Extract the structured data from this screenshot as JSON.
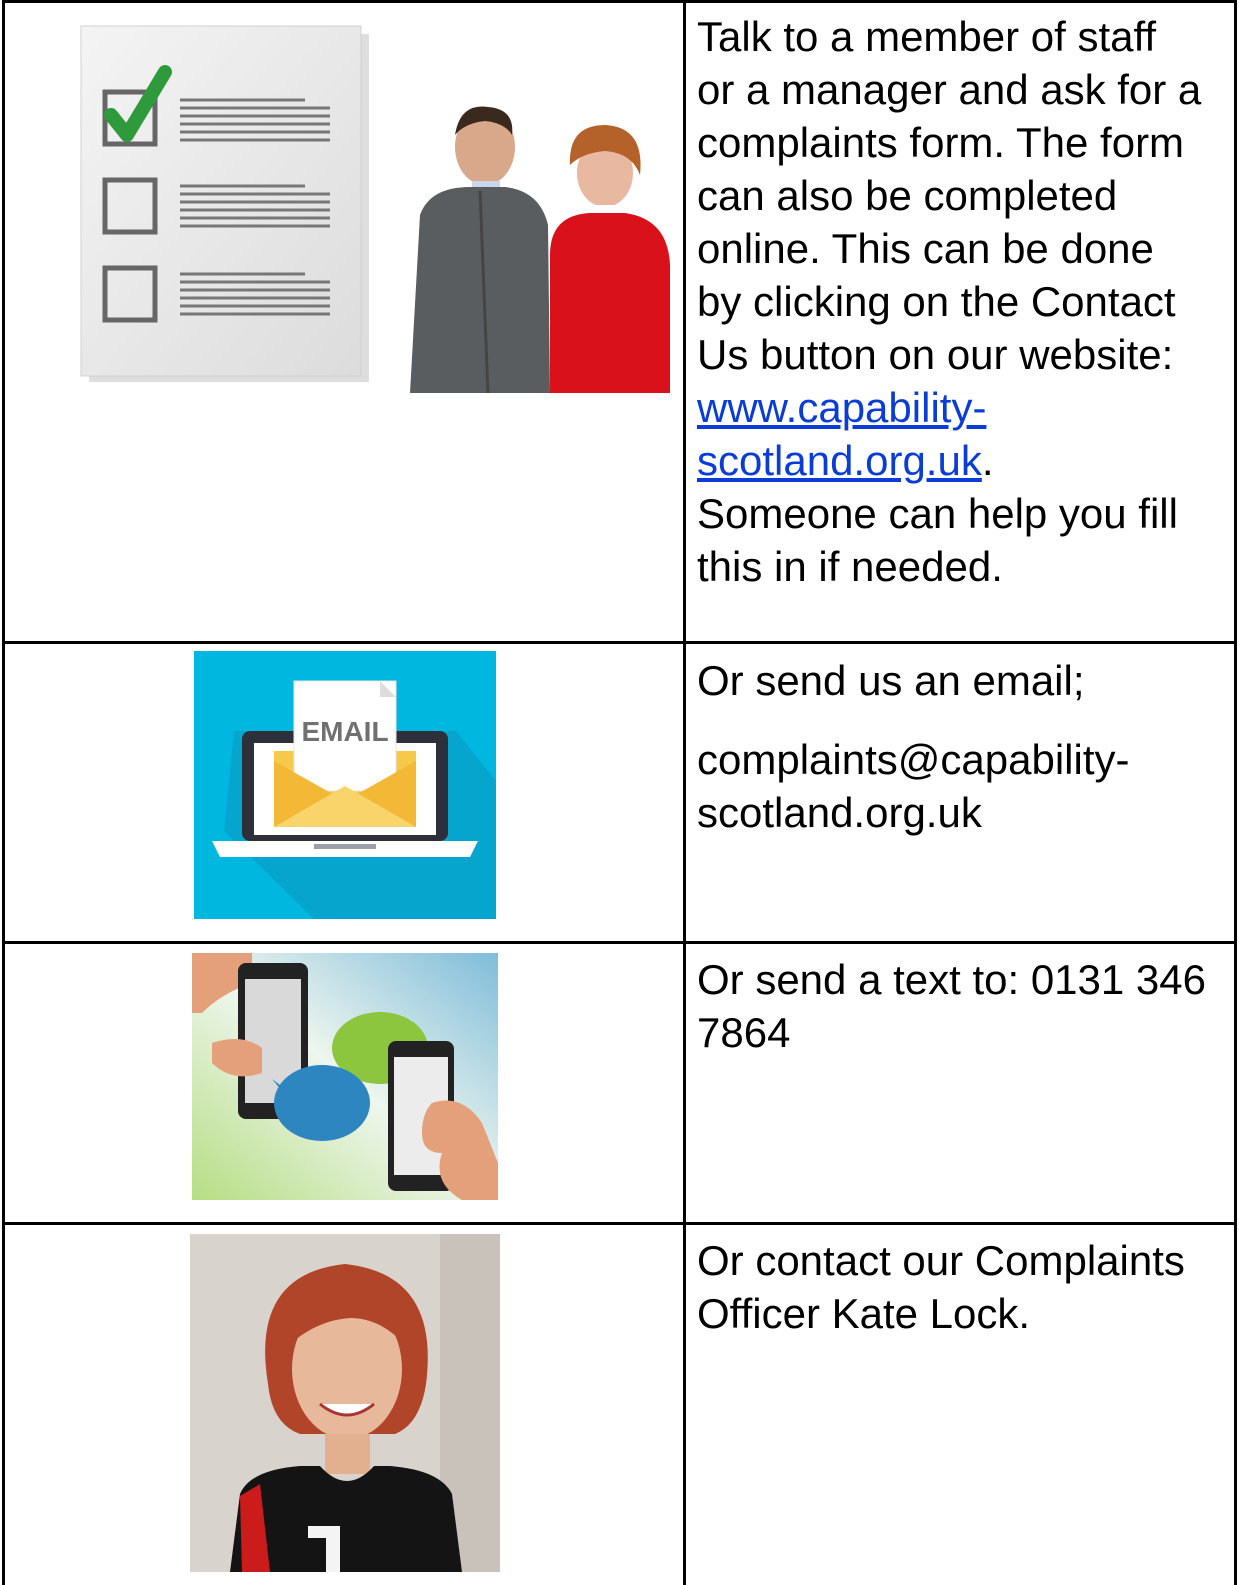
{
  "rows": [
    {
      "lines": [
        "Talk to a member of staff",
        "or a manager and ask for a",
        "complaints form. The form",
        "can also be completed",
        "online. This can be done",
        "by clicking on the Contact",
        "Us button on our website:"
      ],
      "link_line1": "www.capability-",
      "link_line2": "scotland.org.uk",
      "link_suffix": ".",
      "after_lines": [
        "Someone can help you fill",
        "this in if needed."
      ],
      "image": "checklist-and-conversation-illustration"
    },
    {
      "intro": "Or send us an email;",
      "email_line1": "complaints@capability-",
      "email_line2": "scotland.org.uk",
      "image": "email-laptop-illustration",
      "image_text": "EMAIL",
      "image_bg": "#00b7e0"
    },
    {
      "line1": "Or send a text to: 0131 346",
      "line2": "7864",
      "image": "phones-text-message-illustration"
    },
    {
      "line1": "Or contact our Complaints",
      "line2": "Officer Kate Lock.",
      "image": "complaints-officer-photo"
    }
  ],
  "colors": {
    "border": "#000000",
    "link": "#0a3cd6",
    "email_bg": "#00b7e0"
  }
}
